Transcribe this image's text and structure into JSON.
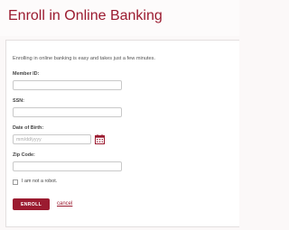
{
  "page": {
    "title": "Enroll in Online Banking",
    "accent_color": "#9b1b30"
  },
  "form": {
    "intro": "Enrolling in online banking is easy and takes just a few minutes.",
    "member_id": {
      "label": "Member ID:",
      "value": "",
      "placeholder": ""
    },
    "ssn": {
      "label": "SSN:",
      "value": "",
      "placeholder": ""
    },
    "dob": {
      "label": "Date of Birth:",
      "value": "",
      "placeholder": "mm/dd/yyyy",
      "icon": "calendar-icon"
    },
    "zip": {
      "label": "Zip Code:",
      "value": "",
      "placeholder": ""
    },
    "robot": {
      "label": "I am not a robot.",
      "checked": false
    },
    "enroll_label": "ENROLL",
    "cancel_label": "cancel"
  }
}
